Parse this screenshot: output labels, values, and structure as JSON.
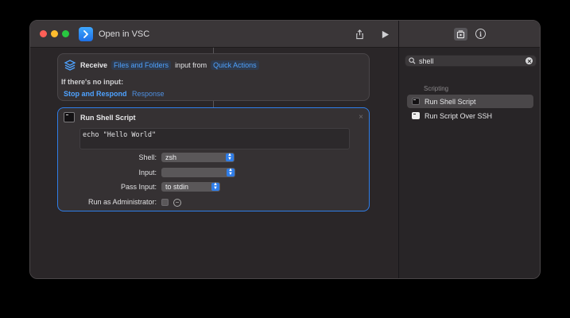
{
  "window": {
    "title": "Open in VSC"
  },
  "receive": {
    "receive_label": "Receive",
    "input_type": "Files and Folders",
    "input_from_label": "input from",
    "source": "Quick Actions",
    "no_input_label": "If there's no input:",
    "action_choice": "Stop and Respond",
    "response_label": "Response"
  },
  "shell_action": {
    "title": "Run Shell Script",
    "close_glyph": "×",
    "script": "echo \"Hello World\"",
    "shell_label": "Shell:",
    "shell_value": "zsh",
    "input_label": "Input:",
    "input_value": "",
    "pass_input_label": "Pass Input:",
    "pass_input_value": "to stdin",
    "admin_label": "Run as Administrator:",
    "admin_checked": false
  },
  "sidebar": {
    "search_value": "shell",
    "section": "Scripting",
    "items": [
      {
        "label": "Run Shell Script",
        "selected": true,
        "icon": "terminal-icon"
      },
      {
        "label": "Run Script Over SSH",
        "selected": false,
        "icon": "ssh-terminal-icon"
      }
    ]
  },
  "colors": {
    "accent": "#2f7de8",
    "link": "#4ea2ff",
    "window_bg": "#2a2628",
    "titlebar_bg": "#3a3638"
  }
}
